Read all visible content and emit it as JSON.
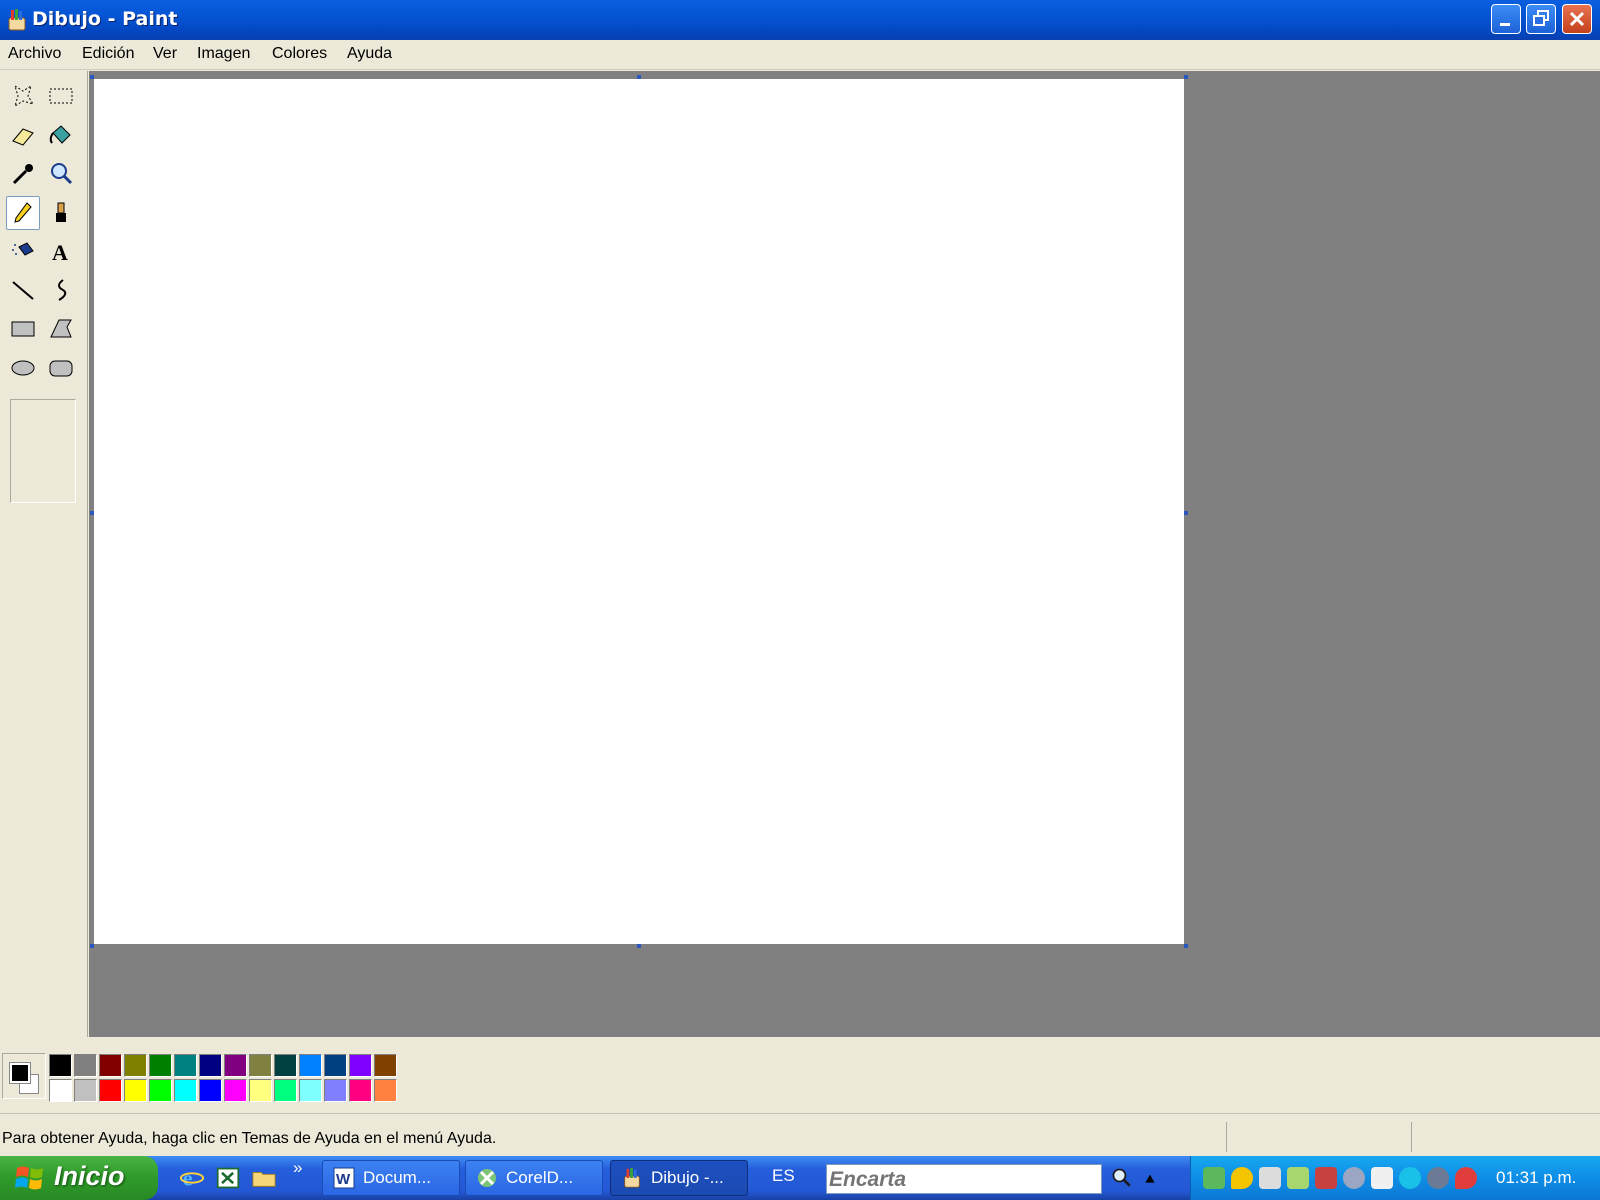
{
  "window": {
    "title": "Dibujo - Paint",
    "controls": [
      "minimize-icon",
      "restore-icon",
      "close-icon"
    ]
  },
  "menu": [
    "Archivo",
    "Edición",
    "Ver",
    "Imagen",
    "Colores",
    "Ayuda"
  ],
  "tools": [
    "free-select-icon",
    "rect-select-icon",
    "eraser-icon",
    "fill-icon",
    "color-picker-icon",
    "magnifier-icon",
    "pencil-icon",
    "brush-icon",
    "airbrush-icon",
    "text-icon",
    "line-icon",
    "curve-icon",
    "rectangle-icon",
    "polygon-icon",
    "ellipse-icon",
    "rounded-rect-icon"
  ],
  "selected_tool": "pencil-icon",
  "colors": {
    "foreground": "#000000",
    "background": "#ffffff",
    "palette_top": [
      "#000000",
      "#808080",
      "#800000",
      "#808000",
      "#008000",
      "#008080",
      "#000080",
      "#800080",
      "#808040",
      "#004040",
      "#0080ff",
      "#004080",
      "#8000ff",
      "#804000"
    ],
    "palette_bottom": [
      "#ffffff",
      "#c0c0c0",
      "#ff0000",
      "#ffff00",
      "#00ff00",
      "#00ffff",
      "#0000ff",
      "#ff00ff",
      "#ffff80",
      "#00ff80",
      "#80ffff",
      "#8080ff",
      "#ff0080",
      "#ff8040"
    ]
  },
  "status": {
    "text": "Para obtener Ayuda, haga clic en Temas de Ayuda en el menú Ayuda."
  },
  "taskbar": {
    "start_label": "Inicio",
    "quicklaunch": [
      "internet-explorer-icon",
      "excel-icon",
      "explorer-icon"
    ],
    "more": "»",
    "buttons": [
      {
        "label": "Docum...",
        "icon": "word-icon"
      },
      {
        "label": "CorelD...",
        "icon": "coreldraw-icon"
      },
      {
        "label": "Dibujo -...",
        "icon": "paint-icon"
      }
    ],
    "language": "ES",
    "encarta_placeholder": "Encarta",
    "clock": "01:31 p.m."
  }
}
